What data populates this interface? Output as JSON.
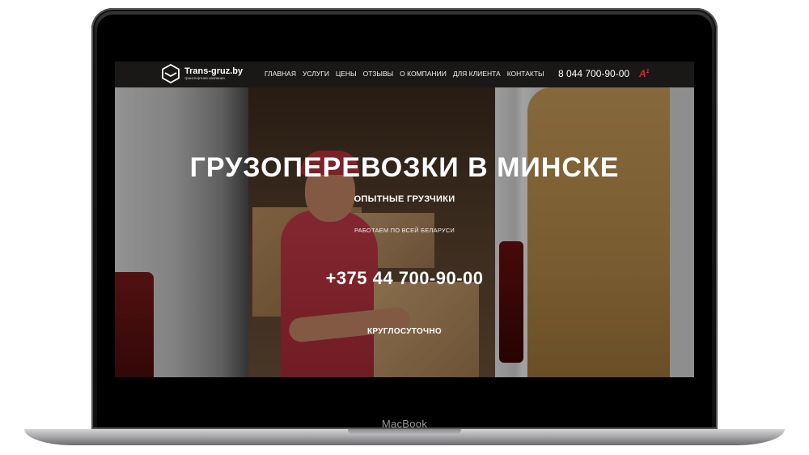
{
  "device": {
    "label": "MacBook"
  },
  "header": {
    "logo_title": "Trans-gruz.by",
    "logo_subtitle": "транспортная компания",
    "nav": [
      "ГЛАВНАЯ",
      "УСЛУГИ",
      "ЦЕНЫ",
      "ОТЗЫВЫ",
      "О КОМПАНИИ",
      "ДЛЯ КЛИЕНТА",
      "КОНТАКТЫ"
    ],
    "phone": "8 044 700-90-00",
    "operator_icon": "A1"
  },
  "hero": {
    "title": "ГРУЗОПЕРЕВОЗКИ В МИНСКЕ",
    "subtitle": "ОПЫТНЫЕ ГРУЗЧИКИ",
    "small": "РАБОТАЕМ ПО ВСЕЙ БЕЛАРУСИ",
    "phone": "+375 44 700-90-00",
    "hours": "КРУГЛОСУТОЧНО"
  },
  "colors": {
    "header_bg": "#1a1817",
    "accent_red": "#e4222a"
  }
}
